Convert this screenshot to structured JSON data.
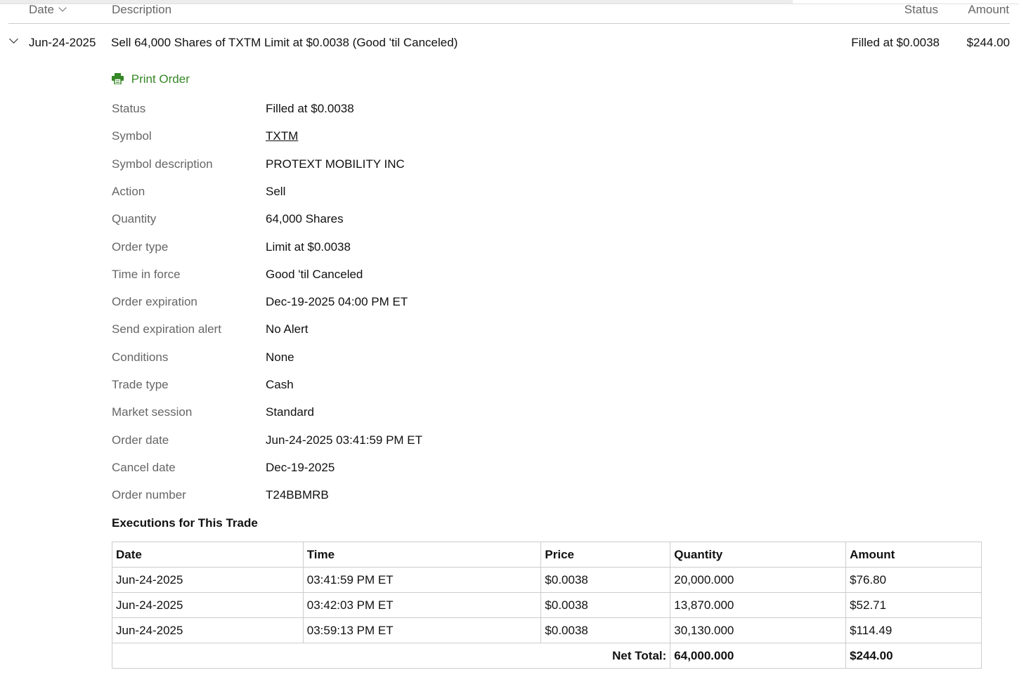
{
  "header": {
    "date": "Date",
    "description": "Description",
    "status": "Status",
    "amount": "Amount"
  },
  "order": {
    "date": "Jun-24-2025",
    "description": "Sell 64,000 Shares of TXTM Limit at $0.0038 (Good 'til Canceled)",
    "status": "Filled at $0.0038",
    "amount": "$244.00"
  },
  "print_label": "Print Order",
  "details": [
    {
      "label": "Status",
      "value": "Filled at $0.0038"
    },
    {
      "label": "Symbol",
      "value": "TXTM"
    },
    {
      "label": "Symbol description",
      "value": "PROTEXT MOBILITY INC"
    },
    {
      "label": "Action",
      "value": "Sell"
    },
    {
      "label": "Quantity",
      "value": "64,000 Shares"
    },
    {
      "label": "Order type",
      "value": "Limit at $0.0038"
    },
    {
      "label": "Time in force",
      "value": "Good 'til Canceled"
    },
    {
      "label": "Order expiration",
      "value": "Dec-19-2025 04:00 PM ET"
    },
    {
      "label": "Send expiration alert",
      "value": "No Alert"
    },
    {
      "label": "Conditions",
      "value": "None"
    },
    {
      "label": "Trade type",
      "value": "Cash"
    },
    {
      "label": "Market session",
      "value": "Standard"
    },
    {
      "label": "Order date",
      "value": "Jun-24-2025 03:41:59 PM ET"
    },
    {
      "label": "Cancel date",
      "value": "Dec-19-2025"
    },
    {
      "label": "Order number",
      "value": "T24BBMRB"
    }
  ],
  "executions": {
    "title": "Executions for This Trade",
    "columns": [
      "Date",
      "Time",
      "Price",
      "Quantity",
      "Amount"
    ],
    "rows": [
      [
        "Jun-24-2025",
        "03:41:59 PM ET",
        "$0.0038",
        "20,000.000",
        "$76.80"
      ],
      [
        "Jun-24-2025",
        "03:42:03 PM ET",
        "$0.0038",
        "13,870.000",
        "$52.71"
      ],
      [
        "Jun-24-2025",
        "03:59:13 PM ET",
        "$0.0038",
        "30,130.000",
        "$114.49"
      ]
    ],
    "net_total_label": "Net Total:",
    "net_quantity": "64,000.000",
    "net_amount": "$244.00"
  }
}
